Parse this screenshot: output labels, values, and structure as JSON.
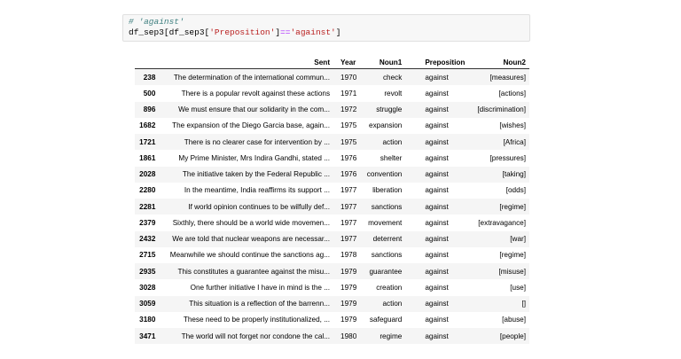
{
  "code_cell": {
    "comment": "# 'against'",
    "line2_prefix": "df_sep3[df_sep3[",
    "line2_key": "'Preposition'",
    "line2_mid": "]",
    "line2_op": "==",
    "line2_value": "'against'",
    "line2_suffix": "]"
  },
  "table": {
    "columns": [
      "",
      "Sent",
      "Year",
      "Noun1",
      "Preposition",
      "Noun2"
    ],
    "rows": [
      [
        "238",
        "The determination of the international commun...",
        "1970",
        "check",
        "against",
        "[measures]"
      ],
      [
        "500",
        "There is a popular revolt against these actions",
        "1971",
        "revolt",
        "against",
        "[actions]"
      ],
      [
        "896",
        "We must ensure that our solidarity in the com...",
        "1972",
        "struggle",
        "against",
        "[discrimination]"
      ],
      [
        "1682",
        "The expansion of the Diego Garcia base, again...",
        "1975",
        "expansion",
        "against",
        "[wishes]"
      ],
      [
        "1721",
        "There is no clearer case for intervention by ...",
        "1975",
        "action",
        "against",
        "[Africa]"
      ],
      [
        "1861",
        "My Prime Minister, Mrs Indira Gandhi, stated ...",
        "1976",
        "shelter",
        "against",
        "[pressures]"
      ],
      [
        "2028",
        "The initiative taken by the Federal Republic ...",
        "1976",
        "convention",
        "against",
        "[taking]"
      ],
      [
        "2280",
        "In the meantime, India reaffirms its support ...",
        "1977",
        "liberation",
        "against",
        "[odds]"
      ],
      [
        "2281",
        "If world opinion continues to be wilfully def...",
        "1977",
        "sanctions",
        "against",
        "[regime]"
      ],
      [
        "2379",
        "Sixthly, there should be a world wide movemen...",
        "1977",
        "movement",
        "against",
        "[extravagance]"
      ],
      [
        "2432",
        "We are told that nuclear weapons are necessar...",
        "1977",
        "deterrent",
        "against",
        "[war]"
      ],
      [
        "2715",
        "Meanwhile we should continue the sanctions ag...",
        "1978",
        "sanctions",
        "against",
        "[regime]"
      ],
      [
        "2935",
        "This constitutes a guarantee against the misu...",
        "1979",
        "guarantee",
        "against",
        "[misuse]"
      ],
      [
        "3028",
        "One further initiative I have in mind is the ...",
        "1979",
        "creation",
        "against",
        "[use]"
      ],
      [
        "3059",
        "This situation is a reflection of the barrenn...",
        "1979",
        "action",
        "against",
        "[]"
      ],
      [
        "3180",
        "These need to be properly institutionalized, ...",
        "1979",
        "safeguard",
        "against",
        "[abuse]"
      ],
      [
        "3471",
        "The world will not forget nor condone the cal...",
        "1980",
        "regime",
        "against",
        "[people]"
      ]
    ]
  }
}
